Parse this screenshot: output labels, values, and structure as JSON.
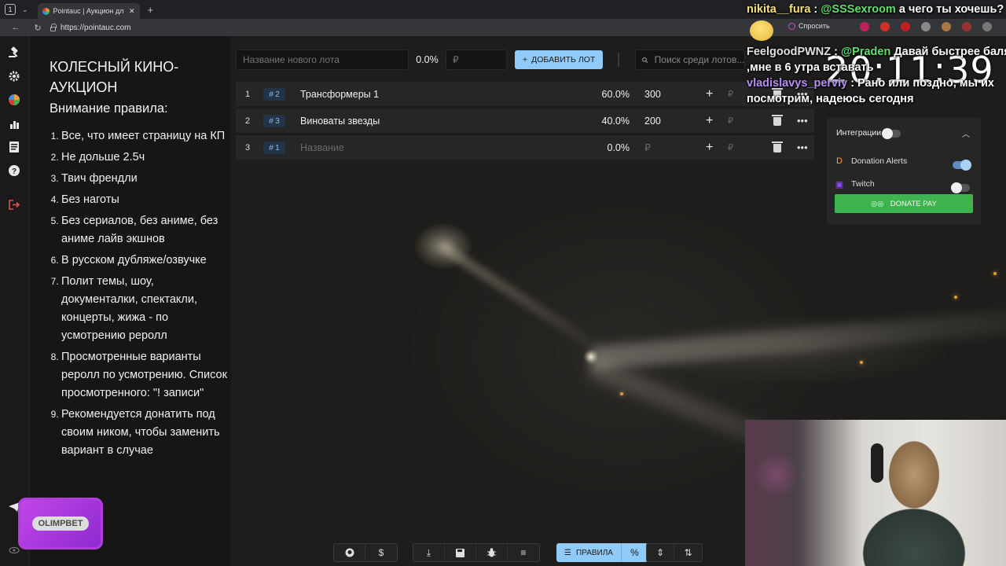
{
  "browser": {
    "tab_count": "1",
    "tab_title": "Pointauc | Аукцион дл",
    "url": "https://pointauc.com"
  },
  "rules": {
    "title": "КОЛЕСНЫЙ КИНО-АУКЦИОН",
    "subtitle": "Внимание правила:",
    "items": [
      "Все, что имеет страницу на КП",
      "Не дольше 2.5ч",
      "Твич френдли",
      "Без наготы",
      "Без сериалов, без аниме, без аниме лайв экшнов",
      "В русском дубляже/озвучке",
      "Полит темы, шоу, документалки, спектакли, концерты, жижа - по усмотрению реролл",
      "Просмотренные варианты реролл по усмотрению. Список просмотренного: \"! записи\"",
      "Рекомендуется донатить под своим ником, чтобы заменить вариант в случае"
    ]
  },
  "toolbar": {
    "lot_name_placeholder": "Название нового лота",
    "percent": "0.0%",
    "amount_placeholder": "₽",
    "add_button": "ДОБАВИТЬ ЛОТ",
    "search_placeholder": "Поиск среди лотов..."
  },
  "lots": [
    {
      "index": "1",
      "id": "2",
      "name": "Трансформеры 1",
      "percent": "60.0%",
      "amount": "300",
      "placeholder": false
    },
    {
      "index": "2",
      "id": "3",
      "name": "Виноваты звезды",
      "percent": "40.0%",
      "amount": "200",
      "placeholder": false
    },
    {
      "index": "3",
      "id": "1",
      "name": "Название",
      "percent": "0.0%",
      "amount": "₽",
      "placeholder": true
    }
  ],
  "integrations": {
    "title": "Интеграции",
    "services": [
      {
        "name": "Donation Alerts",
        "enabled": true
      },
      {
        "name": "Twitch",
        "enabled": false
      }
    ],
    "donate_button": "DONATE PAY"
  },
  "bottom_toolbar": {
    "rules_button": "ПРАВИЛА"
  },
  "overlay": {
    "chat": [
      {
        "user": "nikita__fura",
        "sep": " : ",
        "mention": "@SSSexroom",
        "text": " а чего ты хочешь?"
      },
      {
        "user": "FeelgoodPWNZ",
        "sep": " : ",
        "mention": "@Praden",
        "text": " Давай быстрее баля"
      },
      {
        "user": "",
        "sep": "",
        "mention": "",
        "text": ",мне в 6 утра вставать"
      },
      {
        "user": "vladislavys_perviy",
        "sep": " : ",
        "mention": "",
        "text": " Рано или поздно, мы их"
      },
      {
        "user": "",
        "sep": "",
        "mention": "",
        "text": "посмотрим, надеюсь сегодня"
      }
    ],
    "clock": "20:11:39",
    "ask_label": "Спросить",
    "sponsor": "OLIMPBET"
  },
  "colors": {
    "accent": "#90caf9",
    "donate": "#3fb34f",
    "id_badge": "#233446"
  }
}
